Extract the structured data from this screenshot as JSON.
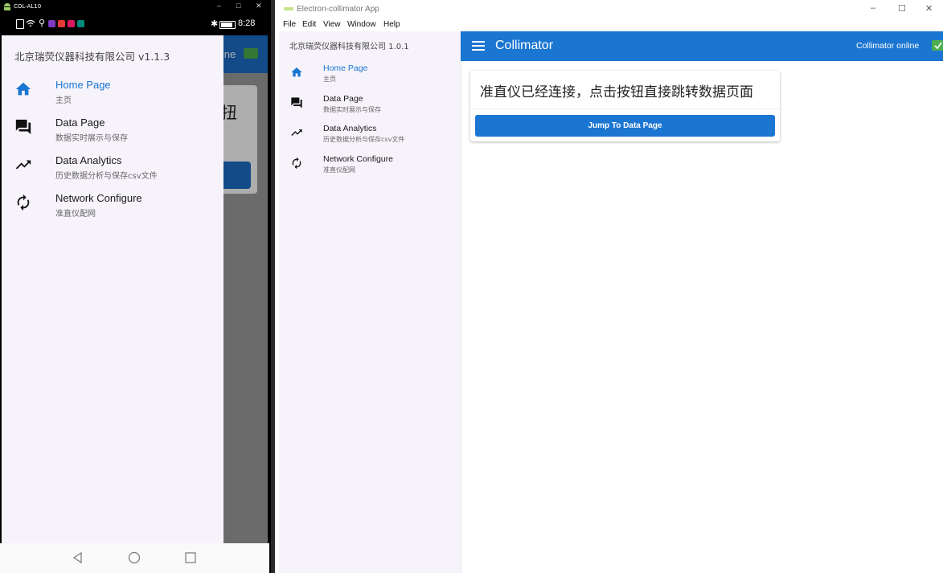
{
  "phone": {
    "window_title": "COL-AL10",
    "status_time": "8:28",
    "company": "北京瑞荧仪器科技有限公司 v1.1.3",
    "behind": {
      "online_text": "line",
      "card_text": "扭"
    },
    "drawer_items": [
      {
        "label": "Home Page",
        "sub": "主页",
        "icon": "home-icon",
        "active": true
      },
      {
        "label": "Data Page",
        "sub": "数据实时展示与保存",
        "icon": "chat-icon",
        "active": false
      },
      {
        "label": "Data Analytics",
        "sub": "历史数据分析与保存csv文件",
        "icon": "trending-up-icon",
        "active": false
      },
      {
        "label": "Network Configure",
        "sub": "准直仪配网",
        "icon": "refresh-icon",
        "active": false
      }
    ]
  },
  "electron": {
    "window_title": "Electron-collimator App",
    "menu": [
      "File",
      "Edit",
      "View",
      "Window",
      "Help"
    ],
    "company": "北京瑞荧仪器科技有限公司 1.0.1",
    "drawer_items": [
      {
        "label": "Home Page",
        "sub": "主页",
        "icon": "home-icon",
        "active": true
      },
      {
        "label": "Data Page",
        "sub": "数据实时展示与保存",
        "icon": "chat-icon",
        "active": false
      },
      {
        "label": "Data Analytics",
        "sub": "历史数据分析与保存csv文件",
        "icon": "trending-up-icon",
        "active": false
      },
      {
        "label": "Network Configure",
        "sub": "准直仪配网",
        "icon": "refresh-icon",
        "active": false
      }
    ],
    "app_title": "Collimator",
    "online_status": "Collimator online",
    "card_text": "准直仪已经连接，点击按钮直接跳转数据页面",
    "jump_button": "Jump To Data Page"
  },
  "colors": {
    "primary": "#1b76d2",
    "active_text": "#1976d2",
    "online_badge": "#4caf50",
    "drawer_bg": "#f7f3fb"
  }
}
